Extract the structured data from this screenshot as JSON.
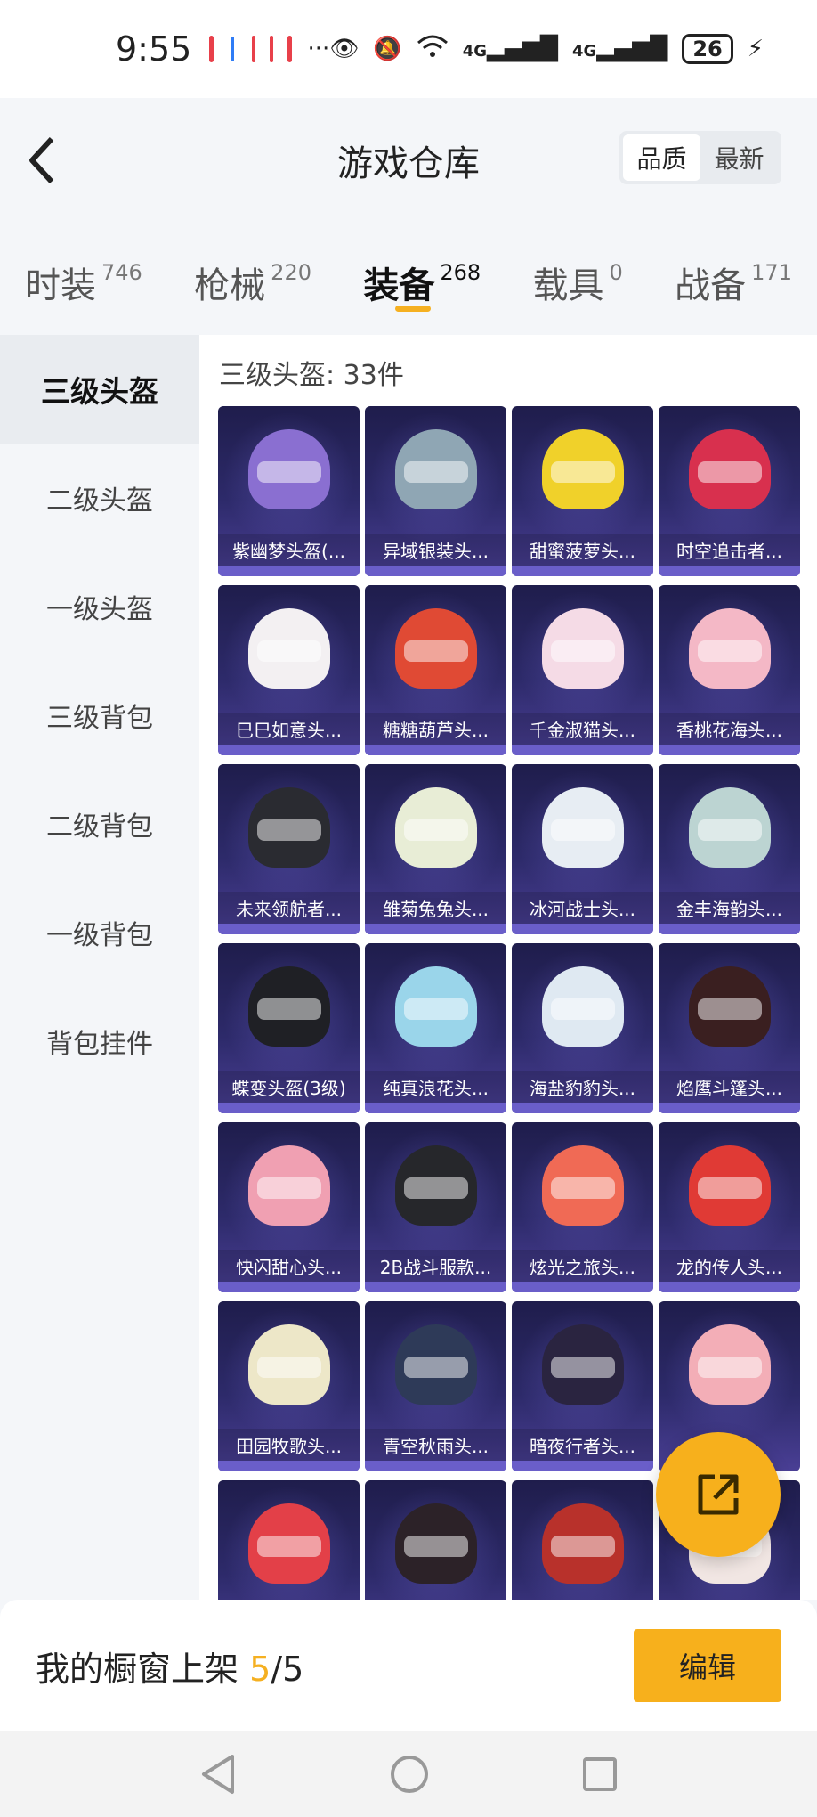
{
  "status_bar": {
    "time": "9:55",
    "signal1": "4G",
    "signal2": "4G",
    "battery": "26"
  },
  "header": {
    "title": "游戏仓库",
    "sort_options": [
      "品质",
      "最新"
    ],
    "sort_active": "品质"
  },
  "category_tabs": [
    {
      "label": "时装",
      "count": "746"
    },
    {
      "label": "枪械",
      "count": "220"
    },
    {
      "label": "装备",
      "count": "268",
      "active": true
    },
    {
      "label": "载具",
      "count": "0"
    },
    {
      "label": "战备",
      "count": "171"
    }
  ],
  "sidebar": {
    "items": [
      "三级头盔",
      "二级头盔",
      "一级头盔",
      "三级背包",
      "二级背包",
      "一级背包",
      "背包挂件"
    ],
    "active": "三级头盔"
  },
  "section_title": "三级头盔: 33件",
  "items": [
    {
      "name": "紫幽梦头盔(...",
      "color": "#8a6fd1"
    },
    {
      "name": "异域银装头...",
      "color": "#8fa6b4"
    },
    {
      "name": "甜蜜菠萝头...",
      "color": "#f0d12a"
    },
    {
      "name": "时空追击者...",
      "color": "#d8304e"
    },
    {
      "name": "巳巳如意头...",
      "color": "#f3f0f2"
    },
    {
      "name": "糖糖葫芦头...",
      "color": "#e04a34"
    },
    {
      "name": "千金淑猫头...",
      "color": "#f5dbe6"
    },
    {
      "name": "香桃花海头...",
      "color": "#f4b8c6"
    },
    {
      "name": "未来领航者...",
      "color": "#2a2b31"
    },
    {
      "name": "雏菊兔兔头...",
      "color": "#e8edd6"
    },
    {
      "name": "冰河战士头...",
      "color": "#e7edf3"
    },
    {
      "name": "金丰海韵头...",
      "color": "#bcd4d2"
    },
    {
      "name": "蝶变头盔(3级)",
      "color": "#1f2025"
    },
    {
      "name": "纯真浪花头...",
      "color": "#9ad5ea"
    },
    {
      "name": "海盐豹豹头...",
      "color": "#dfe9f2"
    },
    {
      "name": "焰鹰斗篷头...",
      "color": "#3a1f20"
    },
    {
      "name": "快闪甜心头...",
      "color": "#f0a0b2"
    },
    {
      "name": "2B战斗服款...",
      "color": "#26272b"
    },
    {
      "name": "炫光之旅头...",
      "color": "#f06a55"
    },
    {
      "name": "龙的传人头...",
      "color": "#e03a35"
    },
    {
      "name": "田园牧歌头...",
      "color": "#ede7c8"
    },
    {
      "name": "青空秋雨头...",
      "color": "#2e3a58"
    },
    {
      "name": "暗夜行者头...",
      "color": "#2a2440"
    },
    {
      "name": "",
      "color": "#f3aeb7"
    },
    {
      "name": "",
      "color": "#e34048"
    },
    {
      "name": "",
      "color": "#2c2228"
    },
    {
      "name": "",
      "color": "#b8312b"
    },
    {
      "name": "",
      "color": "#f1e6e3"
    }
  ],
  "bottom": {
    "shelf_label": "我的橱窗上架",
    "shelf_count": "5",
    "shelf_sep": "/",
    "shelf_total": "5",
    "edit_button": "编辑"
  },
  "colors": {
    "accent": "#f7b01c",
    "card_bg": "#2d2a6a"
  }
}
